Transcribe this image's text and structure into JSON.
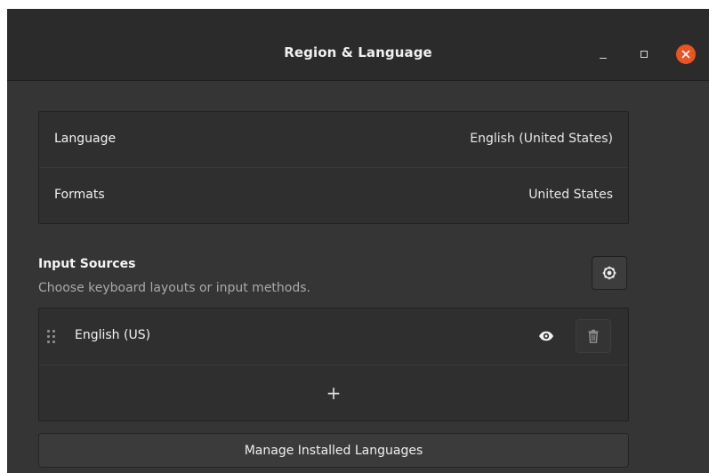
{
  "window": {
    "title": "Region & Language"
  },
  "controls": {
    "minimize_icon": "minimize-icon",
    "maximize_icon": "maximize-icon",
    "close_icon": "close-icon",
    "close_color": "#e95420"
  },
  "language_settings": {
    "language": {
      "label": "Language",
      "value": "English (United States)"
    },
    "formats": {
      "label": "Formats",
      "value": "United States"
    }
  },
  "input_sources": {
    "title": "Input Sources",
    "subtitle": "Choose keyboard layouts or input methods.",
    "settings_icon": "gear-icon",
    "items": [
      {
        "label": "English (US)",
        "handle_icon": "drag-handle-icon",
        "preview_icon": "eye-icon",
        "remove_icon": "trash-icon"
      }
    ],
    "add_label": "+"
  },
  "actions": {
    "manage_label": "Manage Installed Languages"
  }
}
